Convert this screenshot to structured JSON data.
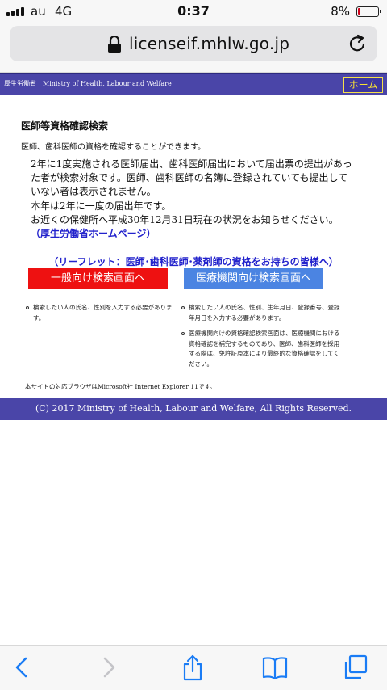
{
  "status_bar": {
    "carrier": "au",
    "network": "4G",
    "time": "0:37",
    "battery": "8%"
  },
  "url_bar": {
    "url": "licenseif.mhlw.go.jp"
  },
  "header": {
    "ministry_name": "厚生労働省　Ministry of Health, Labour and Welfare",
    "home_label": "ホーム"
  },
  "main": {
    "title": "医師等資格確認検索",
    "intro": "医師、歯科医師の資格を確認することができます。",
    "notice": {
      "line1": "2年に1度実施される医師届出、歯科医師届出において届出票の提出があった者が検索対象です。医師、歯科医師の名簿に登録されていても提出していない者は表示されません。",
      "line2": "本年は2年に一度の届出年です。",
      "line3": "お近くの保健所へ平成30年12月31日現在の状況をお知らせください。",
      "link": "（厚生労働省ホームページ）"
    },
    "leaflet_link": "（リーフレット：医師･歯科医師･薬剤師の資格をお持ちの皆様へ）",
    "buttons": {
      "general": "一般向け検索画面へ",
      "medical": "医療機関向け検索画面へ"
    },
    "notes": {
      "general": "検索したい人の氏名、性別を入力する必要があります。",
      "medical_1": "検索したい人の氏名、性別、生年月日、登録番号、登録年月日を入力する必要があります。",
      "medical_2": "医療機関向けの資格確認検索画面は、医療機関における資格確認を補完するものであり、医師、歯科医師を採用する際は、免許証原本により最終的な資格確認をしてください。"
    },
    "browser_note": "本サイトの対応ブラウザはMicrosoft社 Internet Explorer 11です。"
  },
  "footer": {
    "copyright": "(C) 2017 Ministry of Health, Labour and Welfare, All Rights Reserved."
  },
  "toolbar": {
    "icons": [
      "back-icon",
      "forward-icon",
      "share-icon",
      "bookmarks-icon",
      "tabs-icon"
    ]
  },
  "colors": {
    "header_band": "#4a45a8",
    "home_text": "#f8e232",
    "link_blue": "#2222cc",
    "general_button": "#ee1111",
    "medical_button": "#4b84e2",
    "ios_blue": "#1a7cf5"
  }
}
